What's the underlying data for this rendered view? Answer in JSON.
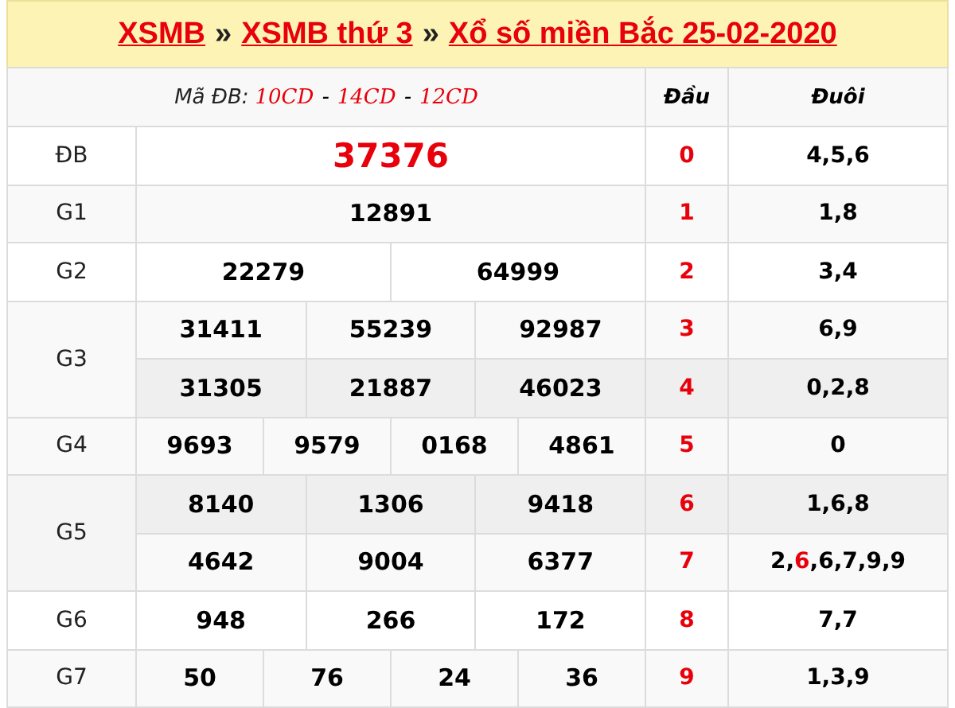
{
  "title": {
    "links": [
      "XSMB",
      "XSMB thứ 3",
      "Xổ số miền Bắc 25-02-2020"
    ],
    "separator": "»"
  },
  "header": {
    "special_codes": {
      "label": "Mã ĐB:",
      "codes": [
        "10CD",
        "14CD",
        "12CD"
      ],
      "separator": "-"
    },
    "head_label": "Đầu",
    "tail_label": "Đuôi"
  },
  "prizes": [
    {
      "label": "ĐB",
      "special": true,
      "lines": [
        [
          "37376"
        ]
      ]
    },
    {
      "label": "G1",
      "special": false,
      "lines": [
        [
          "12891"
        ]
      ]
    },
    {
      "label": "G2",
      "special": false,
      "lines": [
        [
          "22279",
          "64999"
        ]
      ]
    },
    {
      "label": "G3",
      "special": false,
      "lines": [
        [
          "31411",
          "55239",
          "92987"
        ],
        [
          "31305",
          "21887",
          "46023"
        ]
      ]
    },
    {
      "label": "G4",
      "special": false,
      "lines": [
        [
          "9693",
          "9579",
          "0168",
          "4861"
        ]
      ]
    },
    {
      "label": "G5",
      "special": false,
      "lines": [
        [
          "8140",
          "1306",
          "9418"
        ],
        [
          "4642",
          "9004",
          "6377"
        ]
      ]
    },
    {
      "label": "G6",
      "special": false,
      "lines": [
        [
          "948",
          "266",
          "172"
        ]
      ]
    },
    {
      "label": "G7",
      "special": false,
      "lines": [
        [
          "50",
          "76",
          "24",
          "36"
        ]
      ]
    }
  ],
  "head_tail": [
    {
      "head": "0",
      "tail": [
        {
          "text": "4,5,6",
          "highlight": false
        }
      ]
    },
    {
      "head": "1",
      "tail": [
        {
          "text": "1,8",
          "highlight": false
        }
      ]
    },
    {
      "head": "2",
      "tail": [
        {
          "text": "3,4",
          "highlight": false
        }
      ]
    },
    {
      "head": "3",
      "tail": [
        {
          "text": "6,9",
          "highlight": false
        }
      ]
    },
    {
      "head": "4",
      "tail": [
        {
          "text": "0,2,8",
          "highlight": false
        }
      ]
    },
    {
      "head": "5",
      "tail": [
        {
          "text": "0",
          "highlight": false
        }
      ]
    },
    {
      "head": "6",
      "tail": [
        {
          "text": "1,6,8",
          "highlight": false
        }
      ]
    },
    {
      "head": "7",
      "tail": [
        {
          "text": "2,",
          "highlight": false
        },
        {
          "text": "6",
          "highlight": true
        },
        {
          "text": ",6,7,9,9",
          "highlight": false
        }
      ]
    },
    {
      "head": "8",
      "tail": [
        {
          "text": "7,7",
          "highlight": false
        }
      ]
    },
    {
      "head": "9",
      "tail": [
        {
          "text": "1,3,9",
          "highlight": false
        }
      ]
    }
  ]
}
